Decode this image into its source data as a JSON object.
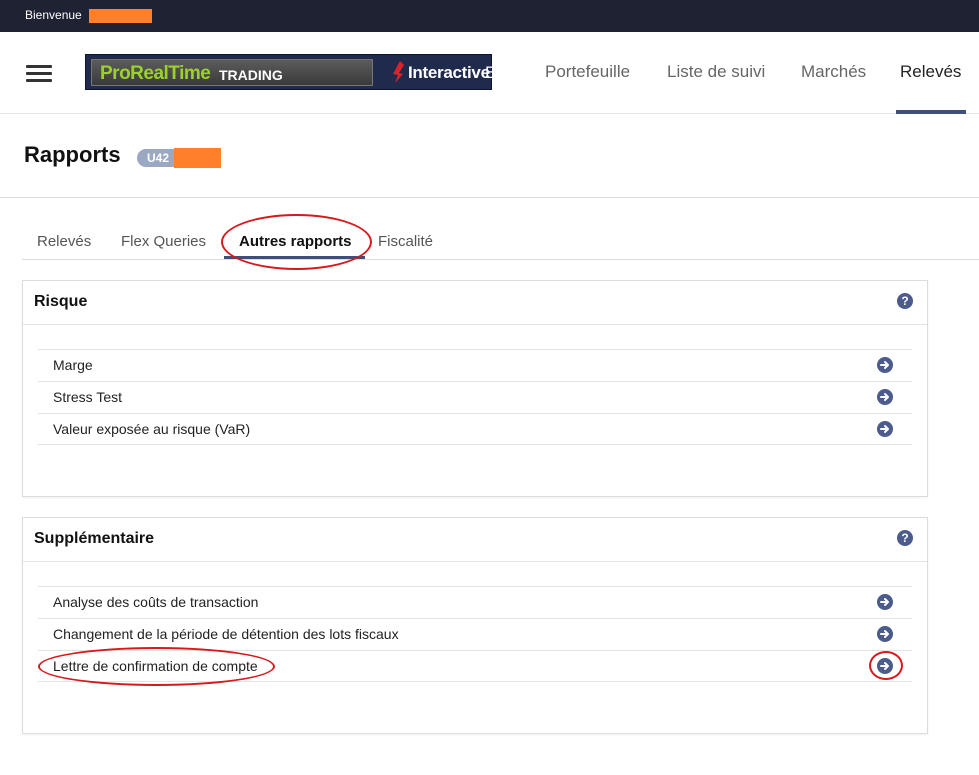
{
  "topbar": {
    "welcome": "Bienvenue"
  },
  "header": {
    "logo": {
      "prt_main": "ProRealTime",
      "prt_sub": "TRADING",
      "ib_a": "Interactive",
      "ib_b": "Brokers"
    },
    "nav": [
      {
        "label": "Portefeuille"
      },
      {
        "label": "Liste de suivi"
      },
      {
        "label": "Marchés"
      },
      {
        "label": "Relevés"
      }
    ]
  },
  "page": {
    "title": "Rapports",
    "account_prefix": "U42"
  },
  "tabs": [
    {
      "label": "Relevés"
    },
    {
      "label": "Flex Queries"
    },
    {
      "label": "Autres rapports"
    },
    {
      "label": "Fiscalité"
    }
  ],
  "panels": [
    {
      "title": "Risque",
      "items": [
        {
          "label": "Marge"
        },
        {
          "label": "Stress Test"
        },
        {
          "label": "Valeur exposée au risque (VaR)"
        }
      ]
    },
    {
      "title": "Supplémentaire",
      "items": [
        {
          "label": "Analyse des coûts de transaction"
        },
        {
          "label": "Changement de la période de détention des lots fiscaux"
        },
        {
          "label": "Lettre de confirmation de compte"
        }
      ]
    }
  ],
  "colors": {
    "topbar": "#1e2232",
    "accent": "#3d4f7a",
    "icon": "#4a5b8c",
    "annotation": "#d7191c",
    "redaction": "#ff7f2a"
  },
  "icons": {
    "menu": "hamburger-icon",
    "help": "question-circle-icon",
    "row_action": "arrow-right-circle-icon"
  }
}
